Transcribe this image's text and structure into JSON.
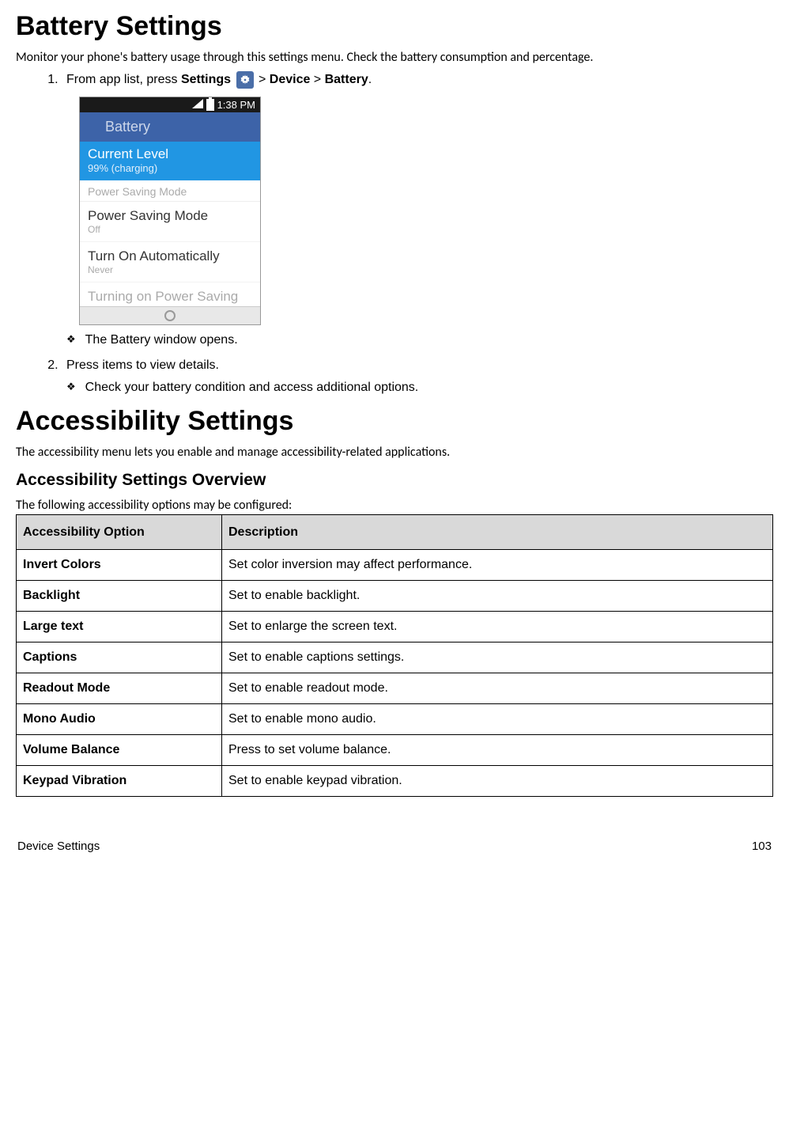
{
  "heading1": "Battery Settings",
  "intro": "Monitor your phone's battery usage through this settings menu. Check the battery consumption and percentage.",
  "step1_prefix": "From app list, press ",
  "step1_bold1": "Settings",
  "step1_gt1": " > ",
  "step1_bold2": "Device",
  "step1_gt2": " > ",
  "step1_bold3": "Battery",
  "step1_suffix": ".",
  "screenshot": {
    "status_time": "1:38 PM",
    "app_header": "Battery",
    "current_level_title": "Current Level",
    "current_level_value": "99% (charging)",
    "section_psm": "Power Saving Mode",
    "psm_title": "Power Saving Mode",
    "psm_value": "Off",
    "auto_title": "Turn On Automatically",
    "auto_value": "Never",
    "turning_on": "Turning on Power Saving"
  },
  "bullet1": "The Battery window opens.",
  "step2": "Press items to view details.",
  "bullet2": "Check your battery condition and access additional options.",
  "heading2": "Accessibility Settings",
  "intro2": "The accessibility menu lets you enable and manage accessibility-related applications.",
  "sub2": "Accessibility Settings Overview",
  "intro3": "The following accessibility options may be configured:",
  "table": {
    "h1": "Accessibility Option",
    "h2": "Description",
    "rows": [
      {
        "opt": "Invert Colors",
        "desc": "Set color inversion may affect performance."
      },
      {
        "opt": "Backlight",
        "desc": "Set to enable backlight."
      },
      {
        "opt": "Large text",
        "desc": "Set to enlarge the screen text."
      },
      {
        "opt": "Captions",
        "desc": "Set to enable captions settings."
      },
      {
        "opt": "Readout Mode",
        "desc": "Set to enable readout mode."
      },
      {
        "opt": "Mono Audio",
        "desc": "Set to enable mono audio."
      },
      {
        "opt": "Volume Balance",
        "desc": "Press to set volume balance."
      },
      {
        "opt": "Keypad Vibration",
        "desc": "Set to enable keypad vibration."
      }
    ]
  },
  "footer_left": "Device Settings",
  "footer_right": "103"
}
